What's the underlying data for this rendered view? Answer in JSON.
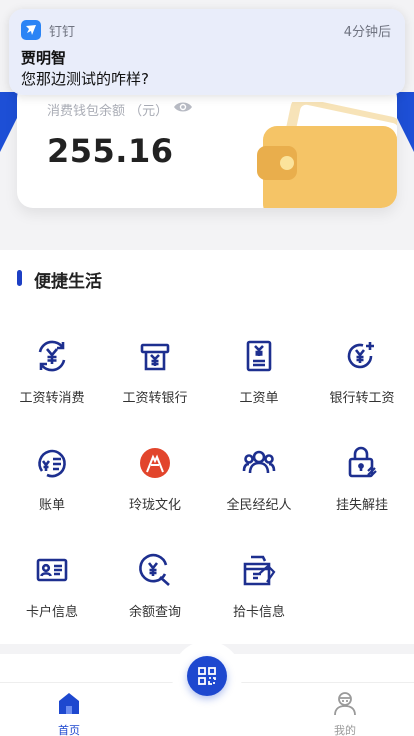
{
  "notification": {
    "app": "钉钉",
    "time": "4分钟后",
    "sender": "贾明智",
    "message": "您那边测试的咋样?"
  },
  "wallet": {
    "balance_label": "消费钱包余额 （元）",
    "balance": "255.16"
  },
  "section": {
    "title": "便捷生活",
    "items": [
      {
        "label": "工资转消费",
        "icon": "salary-to-consume-icon"
      },
      {
        "label": "工资转银行",
        "icon": "salary-to-bank-icon"
      },
      {
        "label": "工资单",
        "icon": "payslip-icon"
      },
      {
        "label": "银行转工资",
        "icon": "bank-to-salary-icon"
      },
      {
        "label": "账单",
        "icon": "bill-icon"
      },
      {
        "label": "玲珑文化",
        "icon": "linglong-culture-icon"
      },
      {
        "label": "全民经纪人",
        "icon": "agent-icon"
      },
      {
        "label": "挂失解挂",
        "icon": "lock-unlock-icon"
      },
      {
        "label": "卡户信息",
        "icon": "card-info-icon"
      },
      {
        "label": "余额查询",
        "icon": "balance-query-icon"
      },
      {
        "label": "拾卡信息",
        "icon": "found-card-icon"
      }
    ]
  },
  "tabbar": {
    "home": "首页",
    "mine": "我的"
  },
  "colors": {
    "accent": "#1e48cf",
    "icon_navy": "#1d2f8f",
    "culture_red": "#e2452c",
    "wallet_yellow": "#f5c466",
    "inactive": "#9a9a9a"
  }
}
